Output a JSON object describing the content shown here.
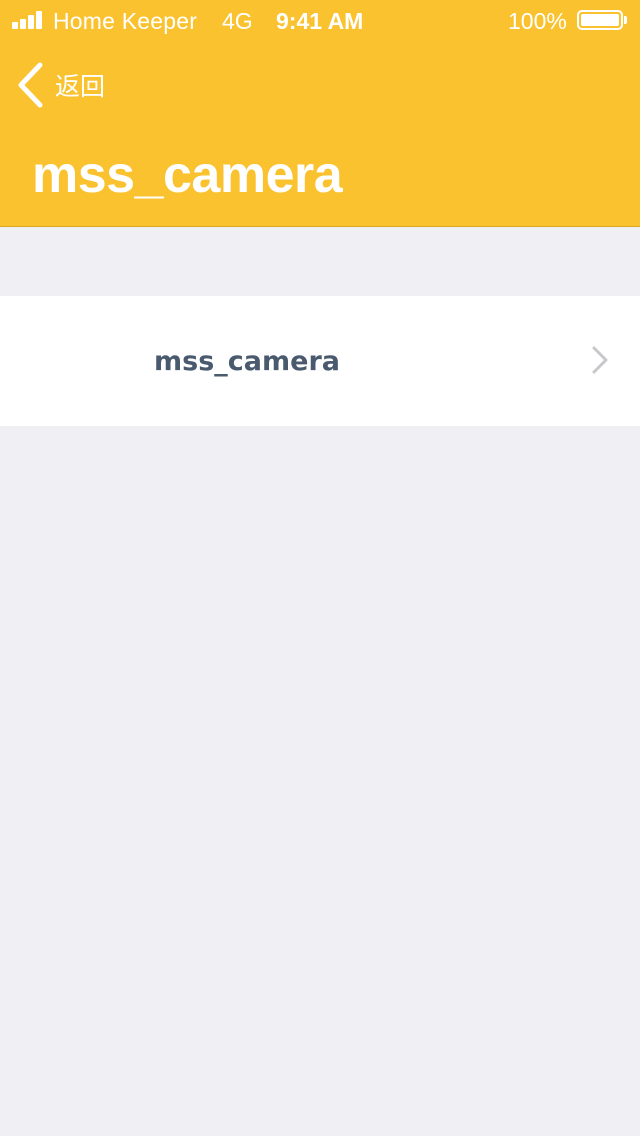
{
  "status_bar": {
    "carrier": "Home Keeper",
    "network": "4G",
    "time": "9:41 AM",
    "battery": "100%",
    "battery_level": 1.0,
    "signal_bars": 4
  },
  "nav": {
    "back_label": "返回",
    "back_icon": "chevron-left-icon",
    "title": "mss_camera"
  },
  "list": {
    "items": [
      {
        "label": "mss_camera",
        "icon": "chevron-right-icon"
      }
    ]
  },
  "colors": {
    "header_background": "#f9c22e",
    "page_background": "#efeff4",
    "item_text": "#4a5a6e",
    "chevron": "#c7c7cc"
  }
}
